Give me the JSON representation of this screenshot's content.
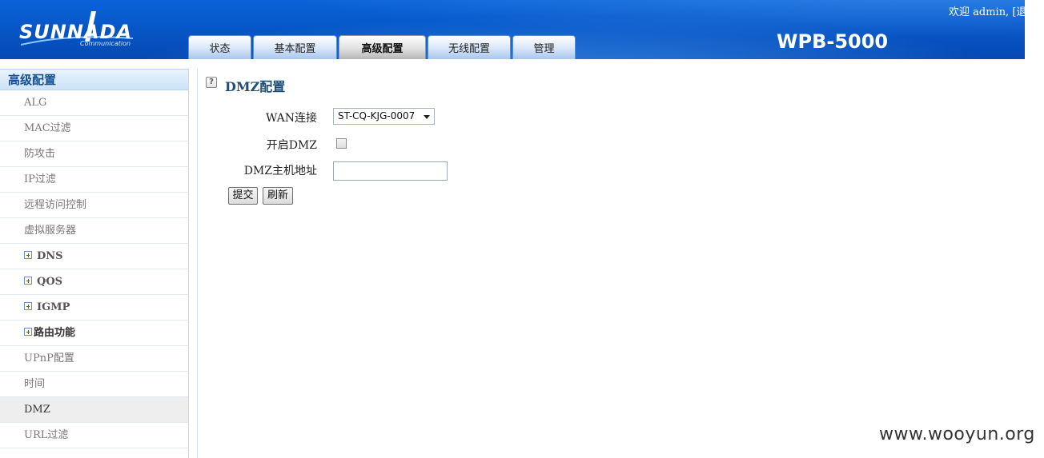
{
  "header": {
    "logo_text": "SUNNADA",
    "logo_sub": "Communication",
    "welcome_prefix": "欢迎 admin, [",
    "logout_label": "退出",
    "welcome_suffix": "]",
    "model": "WPB-5000"
  },
  "tabs": [
    {
      "label": "状态",
      "active": false
    },
    {
      "label": "基本配置",
      "active": false
    },
    {
      "label": "高级配置",
      "active": true
    },
    {
      "label": "无线配置",
      "active": false
    },
    {
      "label": "管理",
      "active": false
    }
  ],
  "sidebar": {
    "title": "高级配置",
    "items": [
      {
        "label": "ALG",
        "group": false
      },
      {
        "label": "MAC过滤",
        "group": false
      },
      {
        "label": "防攻击",
        "group": false
      },
      {
        "label": "IP过滤",
        "group": false
      },
      {
        "label": "远程访问控制",
        "group": false
      },
      {
        "label": "虚拟服务器",
        "group": false
      },
      {
        "label": "DNS",
        "group": true
      },
      {
        "label": "QOS",
        "group": true
      },
      {
        "label": "IGMP",
        "group": true
      },
      {
        "label": "路由功能",
        "group": true
      },
      {
        "label": "UPnP配置",
        "group": false
      },
      {
        "label": "时间",
        "group": false
      },
      {
        "label": "DMZ",
        "group": false,
        "active": true
      },
      {
        "label": "URL过滤",
        "group": false
      }
    ]
  },
  "content": {
    "title": "DMZ配置",
    "help_icon": "?",
    "wan_label": "WAN连接",
    "wan_selected": "ST-CQ-KJG-0007",
    "enable_dmz_label": "开启DMZ",
    "enable_dmz_checked": false,
    "host_label": "DMZ主机地址",
    "host_value": "",
    "submit_label": "提交",
    "refresh_label": "刷新"
  },
  "watermark": "www.wooyun.org"
}
